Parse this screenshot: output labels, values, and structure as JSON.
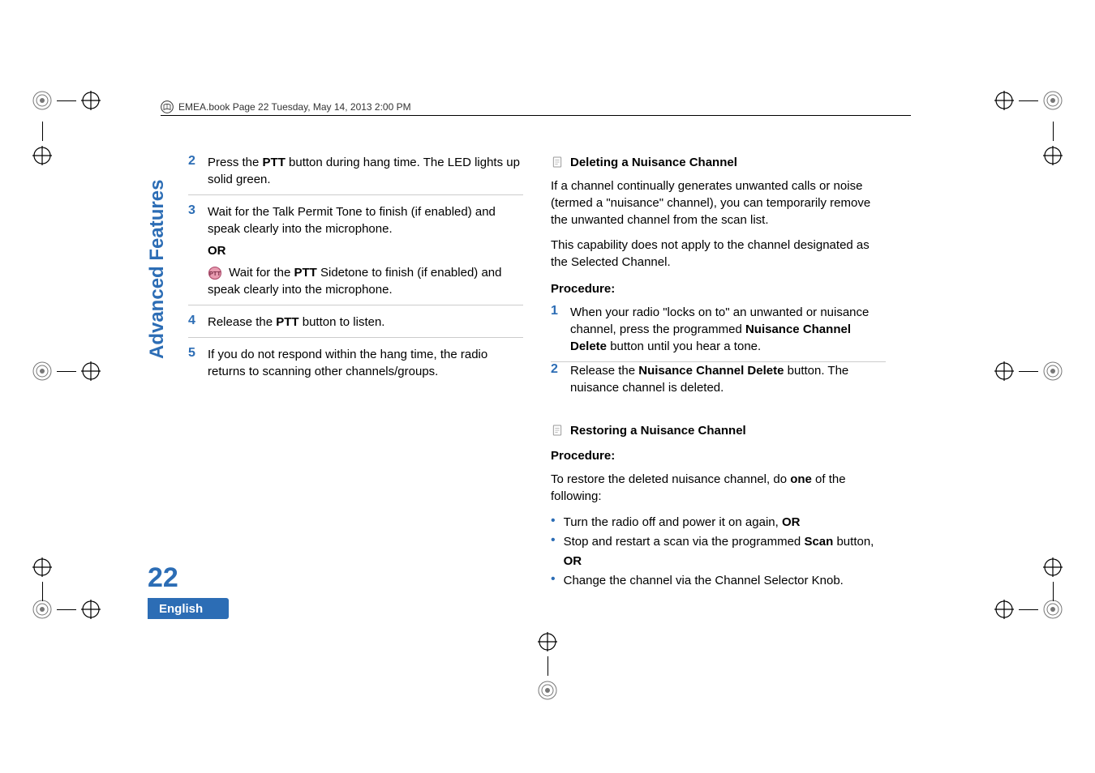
{
  "header": {
    "text": "EMEA.book  Page 22  Tuesday, May 14, 2013  2:00 PM"
  },
  "left_col": {
    "steps": [
      {
        "num": "2",
        "html": "Press the <b>PTT</b> button during hang time. The LED lights up solid green."
      },
      {
        "num": "3",
        "html": "Wait for the Talk Permit Tone to finish (if enabled) and speak clearly into the microphone.<div class='step-spacer'></div><b>OR</b><div class='step-spacer'></div><span class='sub-icon' data-name='ptt-icon' data-interactable='false'><svg viewBox='0 0 24 24'><circle cx='12' cy='12' r='10' fill='#e89bb0' stroke='#b05070' stroke-width='1.5'/><text x='12' y='16' text-anchor='middle' font-size='10' fill='#7a2a45' font-weight='bold'>PTT</text></svg></span> Wait for the <b>PTT</b> Sidetone to finish (if enabled) and speak clearly into the microphone."
      },
      {
        "num": "4",
        "html": "Release the <b>PTT</b> button to listen."
      },
      {
        "num": "5",
        "html": "If you do not respond within the hang time, the radio returns to scanning other channels/groups."
      }
    ]
  },
  "right_col": {
    "deleting": {
      "title": "Deleting a Nuisance Channel",
      "para1": "If a channel continually generates unwanted calls or noise (termed a \"nuisance\" channel), you can temporarily remove the unwanted channel from the scan list.",
      "para2": "This capability does not apply to the channel designated as the Selected Channel.",
      "procedure_label": "Procedure:",
      "steps": [
        {
          "num": "1",
          "html": "When your radio \"locks on to\" an unwanted or nuisance channel, press the programmed <b>Nuisance Channel Delete</b> button until you hear a tone."
        },
        {
          "num": "2",
          "html": "Release the <b>Nuisance Channel Delete</b> button. The nuisance channel is deleted."
        }
      ]
    },
    "restoring": {
      "title": "Restoring a Nuisance Channel",
      "procedure_label": "Procedure:",
      "intro_html": "To restore the deleted nuisance channel, do <b>one</b> of the following:",
      "bullets": [
        "Turn the radio off and power it on again, <b>OR</b>",
        "Stop and restart a scan via the programmed <b>Scan</b> button, <b>OR</b>",
        "Change the channel via the Channel Selector Knob."
      ]
    }
  },
  "side": {
    "tab": "Advanced Features",
    "page_number": "22",
    "language": "English"
  }
}
